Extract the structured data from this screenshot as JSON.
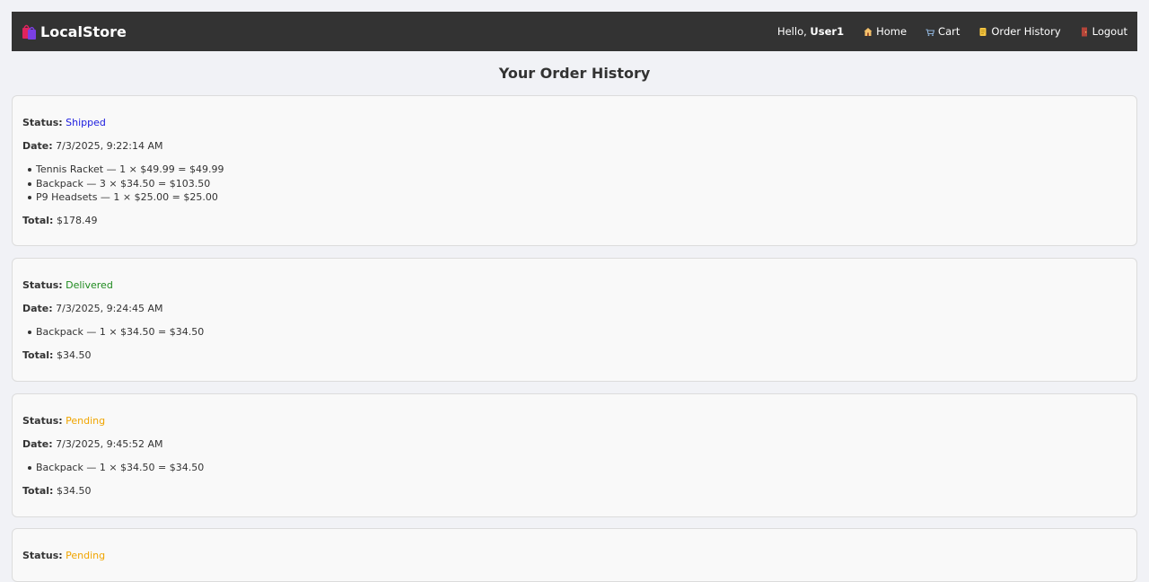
{
  "nav": {
    "brand": "LocalStore",
    "greeting": "Hello,",
    "username": "User1",
    "links": [
      {
        "icon": "home-icon",
        "label": "Home"
      },
      {
        "icon": "cart-icon",
        "label": "Cart"
      },
      {
        "icon": "scroll-icon",
        "label": "Order History"
      },
      {
        "icon": "door-icon",
        "label": "Logout"
      }
    ]
  },
  "page_title": "Your Order History",
  "labels": {
    "status": "Status:",
    "date": "Date:",
    "total": "Total:"
  },
  "colors": {
    "Shipped": "#1a1adf",
    "Delivered": "#1e8a1e",
    "Pending": "#f0a500"
  },
  "orders": [
    {
      "status": "Shipped",
      "date": "7/3/2025, 9:22:14 AM",
      "items": [
        "Tennis Racket — 1 × $49.99 = $49.99",
        "Backpack — 3 × $34.50 = $103.50",
        "P9 Headsets — 1 × $25.00 = $25.00"
      ],
      "total": "$178.49"
    },
    {
      "status": "Delivered",
      "date": "7/3/2025, 9:24:45 AM",
      "items": [
        "Backpack — 1 × $34.50 = $34.50"
      ],
      "total": "$34.50"
    },
    {
      "status": "Pending",
      "date": "7/3/2025, 9:45:52 AM",
      "items": [
        "Backpack — 1 × $34.50 = $34.50"
      ],
      "total": "$34.50"
    },
    {
      "status": "Pending"
    }
  ]
}
